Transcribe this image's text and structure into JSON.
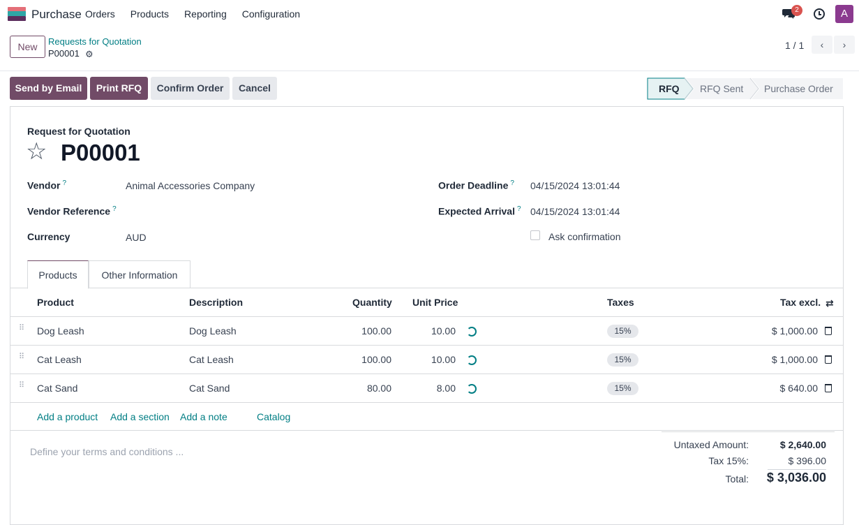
{
  "topbar": {
    "app_name": "Purchase",
    "menu": [
      "Orders",
      "Products",
      "Reporting",
      "Configuration"
    ],
    "chat_badge": "2",
    "avatar_letter": "A"
  },
  "control_panel": {
    "new_label": "New",
    "breadcrumb_parent": "Requests for Quotation",
    "breadcrumb_current": "P00001",
    "pager": "1 / 1"
  },
  "actions": {
    "send_email": "Send by Email",
    "print_rfq": "Print RFQ",
    "confirm": "Confirm Order",
    "cancel": "Cancel"
  },
  "statusbar": [
    "RFQ",
    "RFQ Sent",
    "Purchase Order"
  ],
  "form": {
    "title_label": "Request for Quotation",
    "name": "P00001",
    "vendor_label": "Vendor",
    "vendor_value": "Animal Accessories Company",
    "vendor_ref_label": "Vendor Reference",
    "currency_label": "Currency",
    "currency_value": "AUD",
    "deadline_label": "Order Deadline",
    "deadline_value": "04/15/2024 13:01:44",
    "arrival_label": "Expected Arrival",
    "arrival_value": "04/15/2024 13:01:44",
    "ask_confirmation": "Ask confirmation",
    "help_mark": "?"
  },
  "tabs": [
    "Products",
    "Other Information"
  ],
  "lines": {
    "headers": [
      "Product",
      "Description",
      "Quantity",
      "Unit Price",
      "Taxes",
      "Tax excl."
    ],
    "rows": [
      {
        "product": "Dog Leash",
        "description": "Dog Leash",
        "quantity": "100.00",
        "price": "10.00",
        "tax": "15%",
        "subtotal": "$ 1,000.00"
      },
      {
        "product": "Cat Leash",
        "description": "Cat Leash",
        "quantity": "100.00",
        "price": "10.00",
        "tax": "15%",
        "subtotal": "$ 1,000.00"
      },
      {
        "product": "Cat Sand",
        "description": "Cat Sand",
        "quantity": "80.00",
        "price": "8.00",
        "tax": "15%",
        "subtotal": "$ 640.00"
      }
    ],
    "add_links": [
      "Add a product",
      "Add a section",
      "Add a note",
      "Catalog"
    ]
  },
  "terms_placeholder": "Define your terms and conditions ...",
  "totals": {
    "untaxed_label": "Untaxed Amount:",
    "untaxed_value": "$ 2,640.00",
    "tax_label": "Tax 15%:",
    "tax_value": "$ 396.00",
    "total_label": "Total:",
    "total_value": "$ 3,036.00"
  },
  "colors": {
    "primary": "#714b67",
    "link": "#017e84",
    "badge": "#d9534f"
  }
}
